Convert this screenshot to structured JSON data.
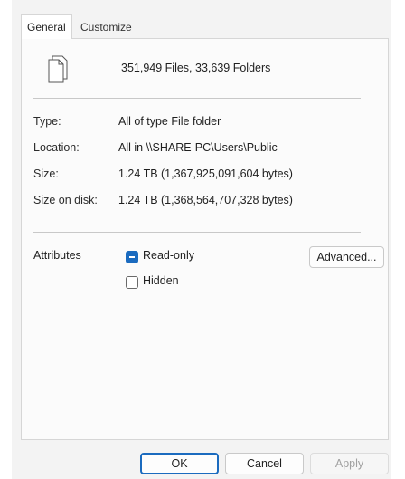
{
  "tabs": [
    {
      "label": "General"
    },
    {
      "label": "Customize"
    }
  ],
  "summary": "351,949 Files, 33,639 Folders",
  "rows": [
    {
      "label": "Type:",
      "value": "All of type File folder"
    },
    {
      "label": "Location:",
      "value": "All in \\\\SHARE-PC\\Users\\Public"
    },
    {
      "label": "Size:",
      "value": "1.24 TB (1,367,925,091,604 bytes)"
    },
    {
      "label": "Size on disk:",
      "value": "1.24 TB (1,368,564,707,328 bytes)"
    }
  ],
  "attributes": {
    "label": "Attributes",
    "read_only": {
      "label": "Read-only",
      "checked": true
    },
    "hidden": {
      "label": "Hidden",
      "checked": false
    },
    "advanced_button": "Advanced..."
  },
  "buttons": {
    "ok": "OK",
    "cancel": "Cancel",
    "apply": "Apply"
  },
  "icons": {
    "folder": "multiple-files-icon"
  },
  "colors": {
    "accent": "#1b6bbf"
  }
}
